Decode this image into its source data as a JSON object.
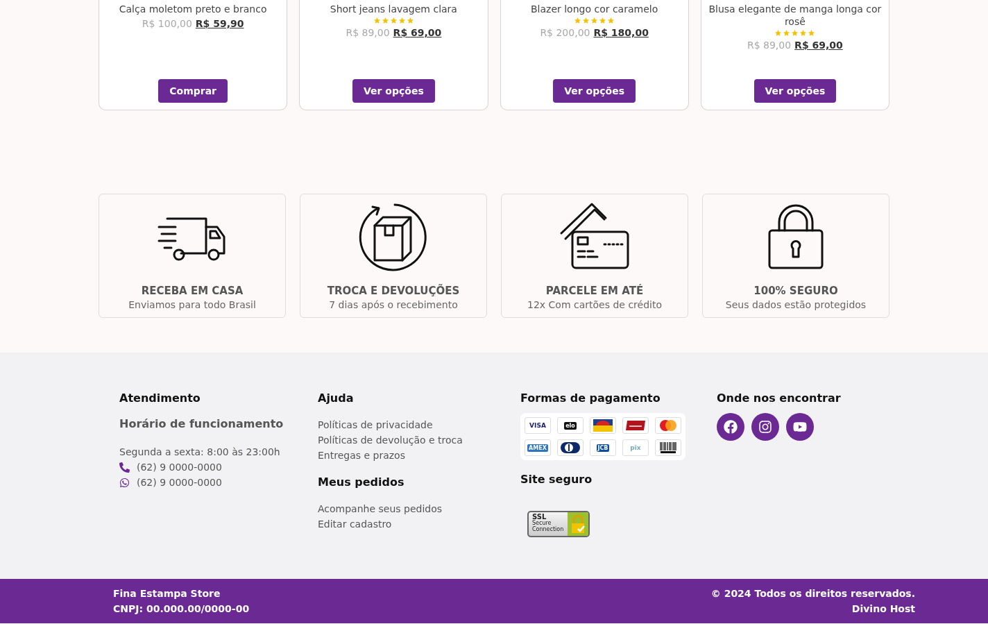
{
  "products": [
    {
      "name": "Calça moletom preto e branco",
      "old_price": "R$ 100,00",
      "price": "R$ 59,90",
      "button": "Comprar"
    },
    {
      "name": "Short jeans lavagem clara",
      "stars": 5,
      "old_price": "R$ 89,00",
      "price": "R$ 69,00",
      "button": "Ver opções"
    },
    {
      "name": "Blazer longo cor caramelo",
      "stars": 5,
      "old_price": "R$ 200,00",
      "price": "R$ 180,00",
      "button": "Ver opções"
    },
    {
      "name": "Blusa elegante de manga longa cor rosê",
      "stars": 5,
      "old_price": "R$ 89,00",
      "price": "R$ 69,00",
      "button": "Ver opções"
    }
  ],
  "features": [
    {
      "kind": "truck",
      "title": "RECEBA EM CASA",
      "subtitle": "Enviamos para todo Brasil"
    },
    {
      "kind": "box",
      "title": "TROCA E DEVOLUÇÕES",
      "subtitle": "7 dias após o recebimento"
    },
    {
      "kind": "cards",
      "title": "PARCELE EM ATÉ",
      "subtitle": "12x Com cartões de crédito"
    },
    {
      "kind": "lock",
      "title": "100% SEGURO",
      "subtitle": "Seus dados estão protegidos"
    }
  ],
  "footer": {
    "service": {
      "heading": "Atendimento",
      "subheading": "Horário de funcionamento",
      "hours": "Segunda a sexta: 8:00 às 23:00h",
      "contacts": [
        {
          "kind": "phone",
          "text": "(62) 9 0000-0000"
        },
        {
          "kind": "whatsapp",
          "text": "(62) 9 0000-0000"
        }
      ]
    },
    "help": {
      "heading": "Ajuda",
      "links": [
        "Políticas de privacidade",
        "Políticas de devolução e troca",
        "Entregas e prazos"
      ]
    },
    "orders": {
      "heading": "Meus pedidos",
      "links": [
        "Acompanhe seus pedidos",
        "Editar cadastro"
      ]
    },
    "payment": {
      "heading": "Formas de pagamento",
      "methods": [
        {
          "kind": "visa",
          "label": "VISA"
        },
        {
          "kind": "elo",
          "label": "elo"
        },
        {
          "kind": "banescard"
        },
        {
          "kind": "hipercard"
        },
        {
          "kind": "mastercard"
        },
        {
          "kind": "amex",
          "label": "AMEX"
        },
        {
          "kind": "diners"
        },
        {
          "kind": "jcb",
          "label": "JCB"
        },
        {
          "kind": "pix",
          "label": "pix"
        },
        {
          "kind": "boleto"
        }
      ]
    },
    "secure": {
      "heading": "Site seguro",
      "badge": [
        "SSL",
        "Secure",
        "Connection"
      ]
    },
    "social": {
      "heading": "Onde nos encontrar",
      "networks": [
        {
          "kind": "facebook"
        },
        {
          "kind": "instagram"
        },
        {
          "kind": "youtube"
        }
      ]
    }
  },
  "bottom_bar": {
    "left": [
      "Fina Estampa Store",
      "CNPJ: 00.000.00/0000-00"
    ],
    "right": [
      "© 2024 Todos os direitos reservados.",
      "Divino Host"
    ]
  }
}
